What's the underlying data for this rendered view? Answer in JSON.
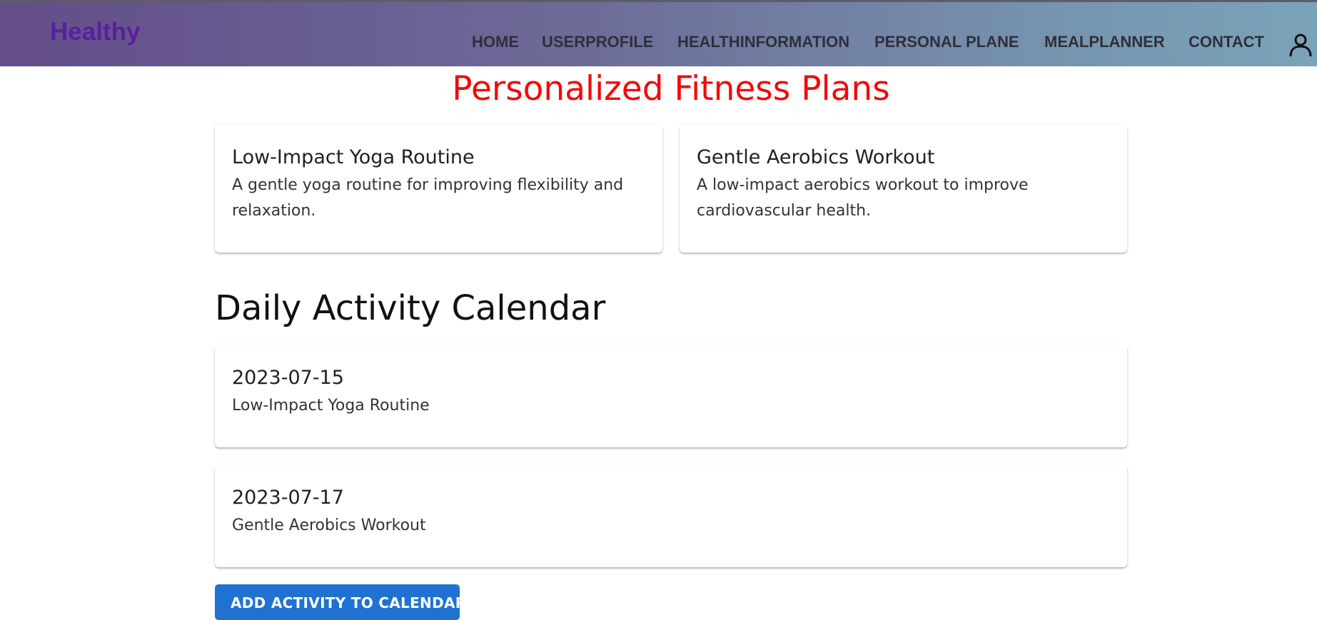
{
  "brand": "Healthy",
  "nav": {
    "items": [
      "HOME",
      "USERPROFILE",
      "HEALTHINFORMATION",
      "PERSONAL PLANE",
      "MEALPLANNER",
      "CONTACT"
    ],
    "user_icon": "person-outline-icon"
  },
  "page": {
    "title": "Personalized Fitness Plans"
  },
  "plans": [
    {
      "title": "Low-Impact Yoga Routine",
      "description": "A gentle yoga routine for improving flexibility and relaxation."
    },
    {
      "title": "Gentle Aerobics Workout",
      "description": "A low-impact aerobics workout to improve cardiovascular health."
    }
  ],
  "calendar": {
    "title": "Daily Activity Calendar",
    "entries": [
      {
        "date": "2023-07-15",
        "activity": "Low-Impact Yoga Routine"
      },
      {
        "date": "2023-07-17",
        "activity": "Gentle Aerobics Workout"
      }
    ],
    "add_button_label": "ADD ACTIVITY TO CALENDAR"
  },
  "colors": {
    "title_accent": "#f40808",
    "brand": "#5a1fa0",
    "button": "#1f72d2"
  }
}
